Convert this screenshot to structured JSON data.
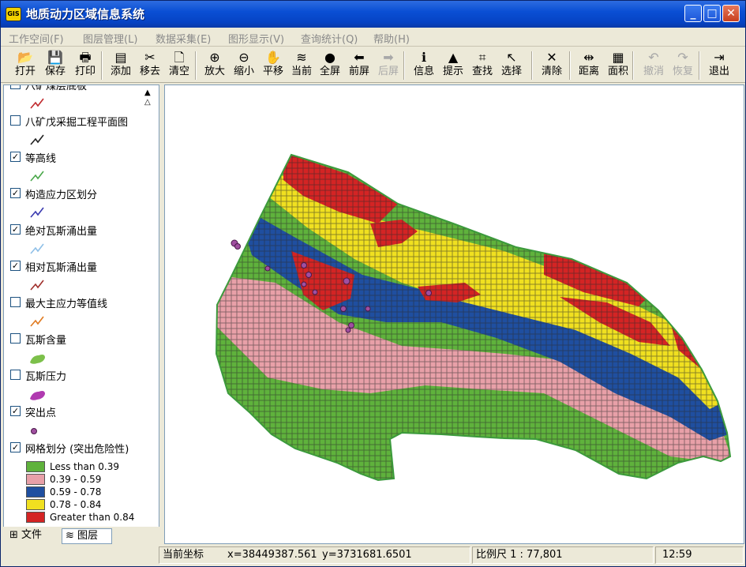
{
  "window": {
    "title": "地质动力区域信息系统",
    "icon": "app-logo-icon",
    "controls": {
      "minimize": "_",
      "maximize": "□",
      "close": "✕"
    }
  },
  "menu": [
    {
      "label": "工作空间(F)"
    },
    {
      "label": "图层管理(L)"
    },
    {
      "label": "数据采集(E)"
    },
    {
      "label": "图形显示(V)"
    },
    {
      "label": "查询统计(Q)"
    },
    {
      "label": "帮助(H)"
    }
  ],
  "toolbar": [
    {
      "label": "打开",
      "icon": "open-folder-icon",
      "glyph": "📂",
      "enabled": true
    },
    {
      "label": "保存",
      "icon": "save-icon",
      "glyph": "💾",
      "enabled": true
    },
    {
      "label": "打印",
      "icon": "print-icon",
      "glyph": "🖶",
      "enabled": true
    },
    {
      "label": "添加",
      "icon": "add-layer-icon",
      "glyph": "▤",
      "enabled": true
    },
    {
      "label": "移去",
      "icon": "remove-layer-icon",
      "glyph": "✂",
      "enabled": true
    },
    {
      "label": "清空",
      "icon": "clear-icon",
      "glyph": "🗋",
      "enabled": true
    },
    {
      "label": "放大",
      "icon": "zoom-in-icon",
      "glyph": "⊕",
      "enabled": true
    },
    {
      "label": "缩小",
      "icon": "zoom-out-icon",
      "glyph": "⊖",
      "enabled": true
    },
    {
      "label": "平移",
      "icon": "pan-hand-icon",
      "glyph": "✋",
      "enabled": true
    },
    {
      "label": "当前",
      "icon": "current-extent-icon",
      "glyph": "≋",
      "enabled": true
    },
    {
      "label": "全屏",
      "icon": "full-extent-globe-icon",
      "glyph": "●",
      "enabled": true
    },
    {
      "label": "前屏",
      "icon": "back-arrow-icon",
      "glyph": "⬅",
      "enabled": true
    },
    {
      "label": "后屏",
      "icon": "forward-arrow-icon",
      "glyph": "➡",
      "enabled": false
    },
    {
      "label": "信息",
      "icon": "info-icon",
      "glyph": "ℹ",
      "enabled": true
    },
    {
      "label": "提示",
      "icon": "warning-tip-icon",
      "glyph": "▲",
      "enabled": true
    },
    {
      "label": "查找",
      "icon": "find-binoculars-icon",
      "glyph": "⌗",
      "enabled": true
    },
    {
      "label": "选择",
      "icon": "select-arrow-icon",
      "glyph": "↖",
      "enabled": true
    },
    {
      "label": "清除",
      "icon": "clear-selection-icon",
      "glyph": "✕",
      "enabled": true
    },
    {
      "label": "距离",
      "icon": "measure-distance-icon",
      "glyph": "⇹",
      "enabled": true
    },
    {
      "label": "面积",
      "icon": "measure-area-icon",
      "glyph": "▦",
      "enabled": true
    },
    {
      "label": "撤消",
      "icon": "undo-icon",
      "glyph": "↶",
      "enabled": false
    },
    {
      "label": "恢复",
      "icon": "redo-icon",
      "glyph": "↷",
      "enabled": false
    },
    {
      "label": "退出",
      "icon": "exit-door-icon",
      "glyph": "⇥",
      "enabled": true
    }
  ],
  "layers": [
    {
      "name": "八矿煤层底板",
      "checked": false,
      "symbol": "line",
      "color": "#c0282c"
    },
    {
      "name": "八矿戊采掘工程平面图",
      "checked": false,
      "symbol": "line",
      "color": "#222222"
    },
    {
      "name": "等高线",
      "checked": true,
      "symbol": "line",
      "color": "#4aa84a"
    },
    {
      "name": "构造应力区划分",
      "checked": true,
      "symbol": "line",
      "color": "#3a3ab0"
    },
    {
      "name": "绝对瓦斯涌出量",
      "checked": true,
      "symbol": "line",
      "color": "#8fc0e8"
    },
    {
      "name": "相对瓦斯涌出量",
      "checked": true,
      "symbol": "line",
      "color": "#a0302c"
    },
    {
      "name": "最大主应力等值线",
      "checked": false,
      "symbol": "line",
      "color": "#e07a20"
    },
    {
      "name": "瓦斯含量",
      "checked": false,
      "symbol": "blob",
      "color": "#7cc04a"
    },
    {
      "name": "瓦斯压力",
      "checked": false,
      "symbol": "blob",
      "color": "#b03ab0"
    },
    {
      "name": "突出点",
      "checked": true,
      "symbol": "point",
      "color": "#a04fa0"
    },
    {
      "name": "网格划分 (突出危险性)",
      "checked": true,
      "symbol": "legend",
      "color": ""
    }
  ],
  "legend": [
    {
      "label": "Less than 0.39",
      "color": "#5fb23c"
    },
    {
      "label": "0.39 - 0.59",
      "color": "#e8a0a8"
    },
    {
      "label": "0.59 - 0.78",
      "color": "#1f4fa0"
    },
    {
      "label": "0.78 - 0.84",
      "color": "#f0e020"
    },
    {
      "label": "Greater than 0.84",
      "color": "#d42424"
    }
  ],
  "tabs": {
    "files": "文件",
    "layers": "图层"
  },
  "status": {
    "coord_label": "当前坐标",
    "x": "x=38449387.561",
    "y": "y=3731681.6501",
    "scale": "比例尺 1 : 77,801",
    "time": "12:59"
  }
}
